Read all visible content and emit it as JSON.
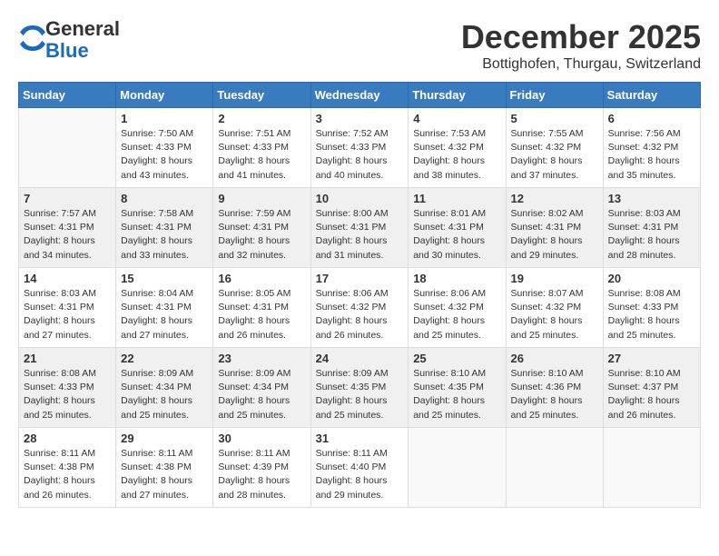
{
  "logo": {
    "general": "General",
    "blue": "Blue"
  },
  "title": "December 2025",
  "location": "Bottighofen, Thurgau, Switzerland",
  "days_of_week": [
    "Sunday",
    "Monday",
    "Tuesday",
    "Wednesday",
    "Thursday",
    "Friday",
    "Saturday"
  ],
  "weeks": [
    [
      {
        "day": "",
        "empty": true
      },
      {
        "day": "1",
        "sunrise": "7:50 AM",
        "sunset": "4:33 PM",
        "daylight": "8 hours and 43 minutes."
      },
      {
        "day": "2",
        "sunrise": "7:51 AM",
        "sunset": "4:33 PM",
        "daylight": "8 hours and 41 minutes."
      },
      {
        "day": "3",
        "sunrise": "7:52 AM",
        "sunset": "4:33 PM",
        "daylight": "8 hours and 40 minutes."
      },
      {
        "day": "4",
        "sunrise": "7:53 AM",
        "sunset": "4:32 PM",
        "daylight": "8 hours and 38 minutes."
      },
      {
        "day": "5",
        "sunrise": "7:55 AM",
        "sunset": "4:32 PM",
        "daylight": "8 hours and 37 minutes."
      },
      {
        "day": "6",
        "sunrise": "7:56 AM",
        "sunset": "4:32 PM",
        "daylight": "8 hours and 35 minutes."
      }
    ],
    [
      {
        "day": "7",
        "sunrise": "7:57 AM",
        "sunset": "4:31 PM",
        "daylight": "8 hours and 34 minutes."
      },
      {
        "day": "8",
        "sunrise": "7:58 AM",
        "sunset": "4:31 PM",
        "daylight": "8 hours and 33 minutes."
      },
      {
        "day": "9",
        "sunrise": "7:59 AM",
        "sunset": "4:31 PM",
        "daylight": "8 hours and 32 minutes."
      },
      {
        "day": "10",
        "sunrise": "8:00 AM",
        "sunset": "4:31 PM",
        "daylight": "8 hours and 31 minutes."
      },
      {
        "day": "11",
        "sunrise": "8:01 AM",
        "sunset": "4:31 PM",
        "daylight": "8 hours and 30 minutes."
      },
      {
        "day": "12",
        "sunrise": "8:02 AM",
        "sunset": "4:31 PM",
        "daylight": "8 hours and 29 minutes."
      },
      {
        "day": "13",
        "sunrise": "8:03 AM",
        "sunset": "4:31 PM",
        "daylight": "8 hours and 28 minutes."
      }
    ],
    [
      {
        "day": "14",
        "sunrise": "8:03 AM",
        "sunset": "4:31 PM",
        "daylight": "8 hours and 27 minutes."
      },
      {
        "day": "15",
        "sunrise": "8:04 AM",
        "sunset": "4:31 PM",
        "daylight": "8 hours and 27 minutes."
      },
      {
        "day": "16",
        "sunrise": "8:05 AM",
        "sunset": "4:31 PM",
        "daylight": "8 hours and 26 minutes."
      },
      {
        "day": "17",
        "sunrise": "8:06 AM",
        "sunset": "4:32 PM",
        "daylight": "8 hours and 26 minutes."
      },
      {
        "day": "18",
        "sunrise": "8:06 AM",
        "sunset": "4:32 PM",
        "daylight": "8 hours and 25 minutes."
      },
      {
        "day": "19",
        "sunrise": "8:07 AM",
        "sunset": "4:32 PM",
        "daylight": "8 hours and 25 minutes."
      },
      {
        "day": "20",
        "sunrise": "8:08 AM",
        "sunset": "4:33 PM",
        "daylight": "8 hours and 25 minutes."
      }
    ],
    [
      {
        "day": "21",
        "sunrise": "8:08 AM",
        "sunset": "4:33 PM",
        "daylight": "8 hours and 25 minutes."
      },
      {
        "day": "22",
        "sunrise": "8:09 AM",
        "sunset": "4:34 PM",
        "daylight": "8 hours and 25 minutes."
      },
      {
        "day": "23",
        "sunrise": "8:09 AM",
        "sunset": "4:34 PM",
        "daylight": "8 hours and 25 minutes."
      },
      {
        "day": "24",
        "sunrise": "8:09 AM",
        "sunset": "4:35 PM",
        "daylight": "8 hours and 25 minutes."
      },
      {
        "day": "25",
        "sunrise": "8:10 AM",
        "sunset": "4:35 PM",
        "daylight": "8 hours and 25 minutes."
      },
      {
        "day": "26",
        "sunrise": "8:10 AM",
        "sunset": "4:36 PM",
        "daylight": "8 hours and 25 minutes."
      },
      {
        "day": "27",
        "sunrise": "8:10 AM",
        "sunset": "4:37 PM",
        "daylight": "8 hours and 26 minutes."
      }
    ],
    [
      {
        "day": "28",
        "sunrise": "8:11 AM",
        "sunset": "4:38 PM",
        "daylight": "8 hours and 26 minutes."
      },
      {
        "day": "29",
        "sunrise": "8:11 AM",
        "sunset": "4:38 PM",
        "daylight": "8 hours and 27 minutes."
      },
      {
        "day": "30",
        "sunrise": "8:11 AM",
        "sunset": "4:39 PM",
        "daylight": "8 hours and 28 minutes."
      },
      {
        "day": "31",
        "sunrise": "8:11 AM",
        "sunset": "4:40 PM",
        "daylight": "8 hours and 29 minutes."
      },
      {
        "day": "",
        "empty": true
      },
      {
        "day": "",
        "empty": true
      },
      {
        "day": "",
        "empty": true
      }
    ]
  ],
  "labels": {
    "sunrise": "Sunrise:",
    "sunset": "Sunset:",
    "daylight": "Daylight:"
  }
}
